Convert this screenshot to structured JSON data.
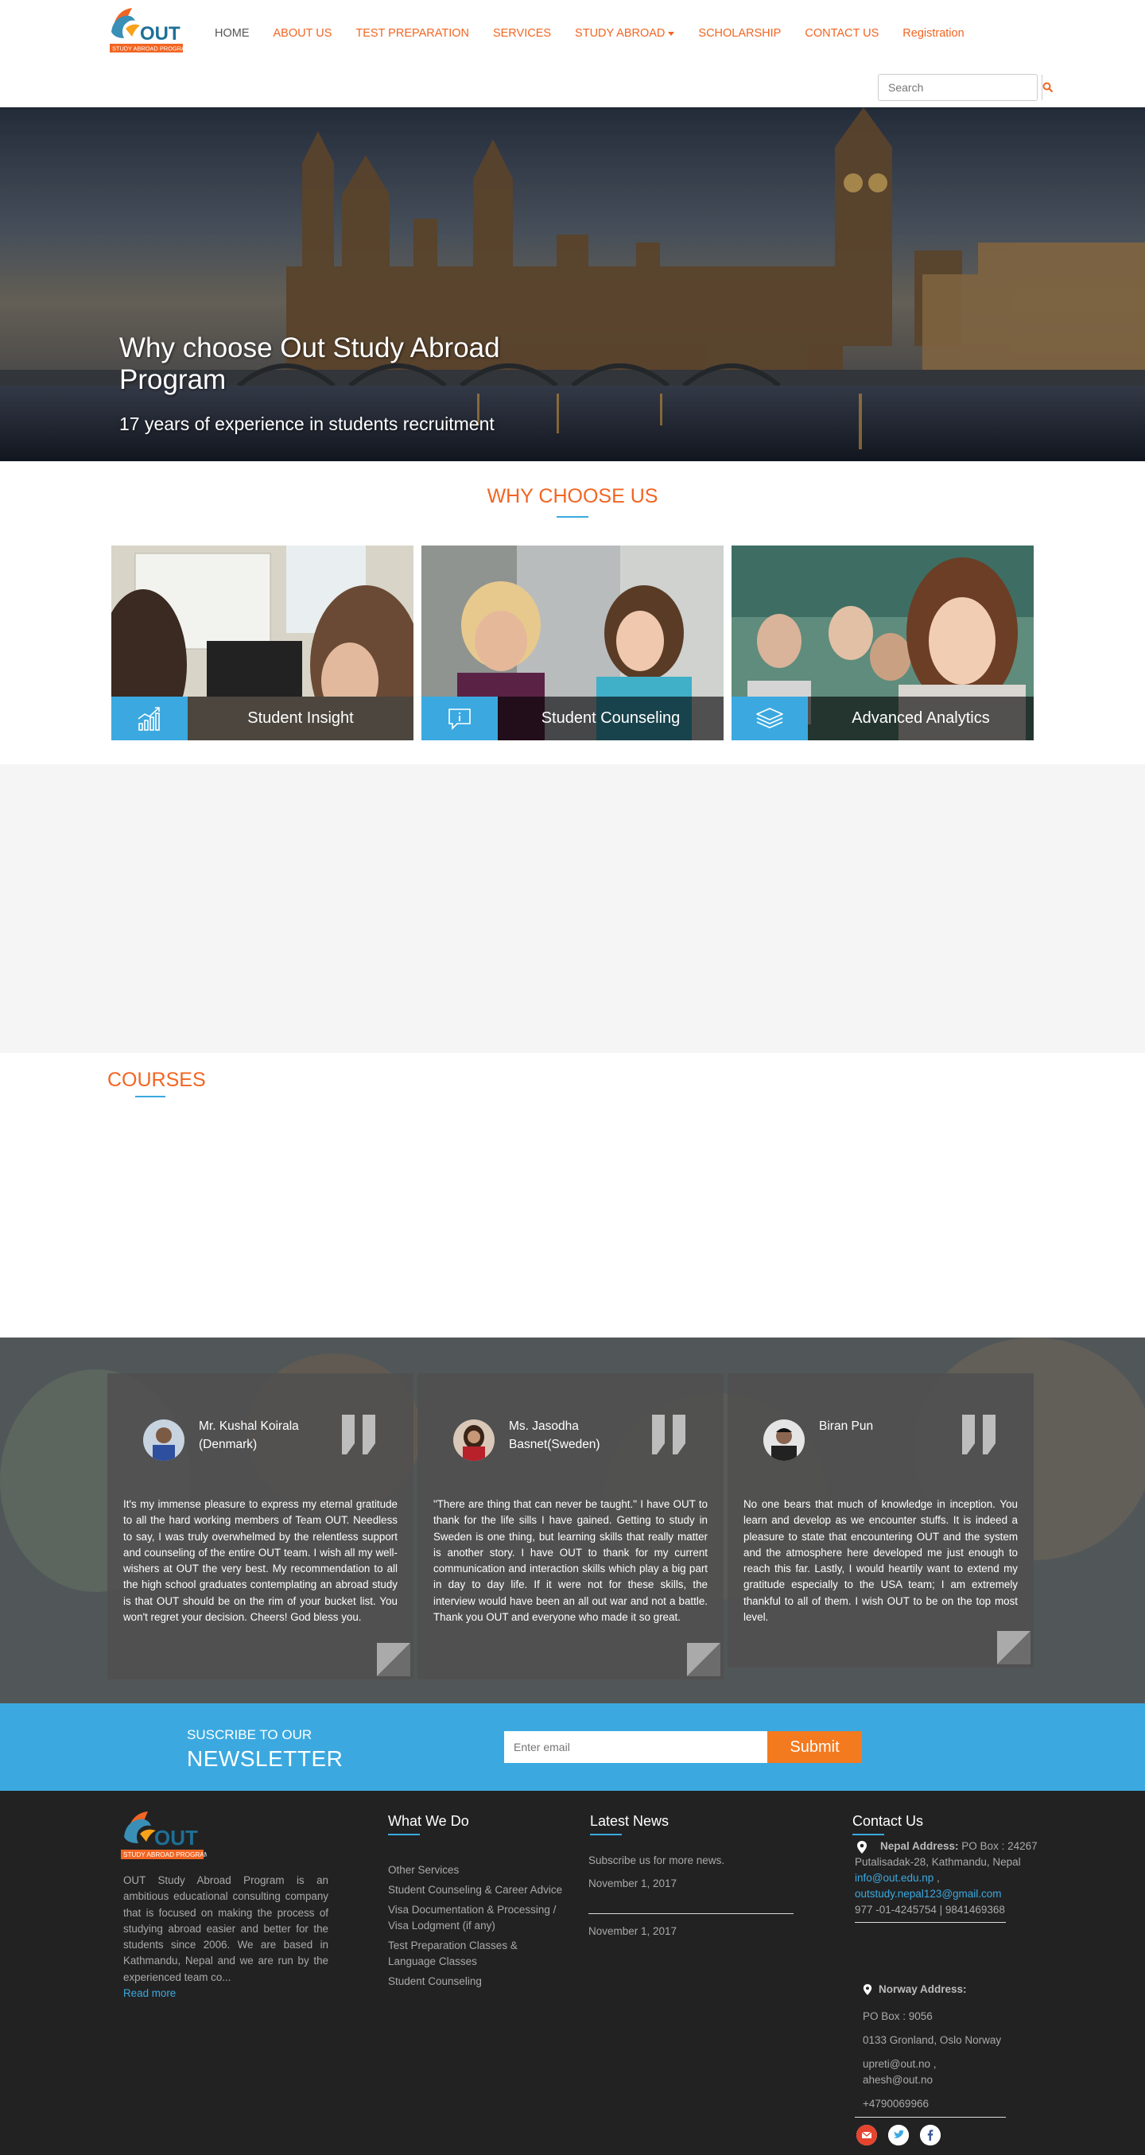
{
  "brand": {
    "logo_text": "OUT",
    "logo_sub": "STUDY ABROAD PROGRAMS"
  },
  "nav": {
    "items": [
      {
        "label": "HOME"
      },
      {
        "label": "ABOUT US"
      },
      {
        "label": "TEST PREPARATION"
      },
      {
        "label": "SERVICES"
      },
      {
        "label": "STUDY ABROAD"
      },
      {
        "label": "SCHOLARSHIP"
      },
      {
        "label": "CONTACT US"
      },
      {
        "label": "Registration"
      }
    ]
  },
  "search": {
    "placeholder": "Search",
    "icon": "search-icon"
  },
  "hero": {
    "title": "Why choose Out Study Abroad Program",
    "subtitle": "17 years of experience in students recruitment"
  },
  "why": {
    "title": "WHY CHOOSE US",
    "cards": [
      {
        "label": "Student Insight",
        "icon": "chart-growth-icon"
      },
      {
        "label": "Student Counseling",
        "icon": "info-speech-icon"
      },
      {
        "label": "Advanced Analytics",
        "icon": "layers-icon"
      }
    ]
  },
  "courses": {
    "title": "COURSES"
  },
  "testimonials": [
    {
      "name": "Mr. Kushal Koirala (Denmark)",
      "text": "It's my immense pleasure to express my eternal gratitude to all the hard working members of Team OUT. Needless to say, I was truly overwhelmed by the relentless support and counseling of the entire OUT team. I wish all my well-wishers at OUT the very best. My recommendation to all the high school graduates contemplating an abroad study is that OUT should be on the rim of your bucket list. You won't regret your decision. Cheers! God bless you."
    },
    {
      "name": "Ms. Jasodha Basnet(Sweden)",
      "text": "\"There are thing that can never be taught.\" I have OUT to thank for the life sills I have gained. Getting to study in Sweden is one thing, but learning skills that really matter is another story. I have OUT to thank for my current communication and interaction skills which play a big part in day to day life. If it were not for these skills, the interview would have been an all out war and not a battle. Thank you OUT and everyone who made it so great."
    },
    {
      "name": "Biran Pun",
      "text": "No one bears that much of knowledge in inception. You learn and develop as we encounter stuffs. It is indeed a pleasure to state that encountering OUT and the system and the atmosphere here developed me just enough to reach this far. Lastly, I would heartily want to extend my gratitude especially to the USA team; I am extremely thankful to all of them. I wish OUT to be on the top most level."
    }
  ],
  "newsletter": {
    "small": "SUSCRIBE TO OUR",
    "big": "NEWSLETTER",
    "placeholder": "Enter email",
    "button": "Submit"
  },
  "footer": {
    "about": "OUT Study Abroad Program is an ambitious educational consulting company that is focused on making the process of studying abroad easier and better for the students since 2006. We are based in Kathmandu, Nepal and we are run by the experienced team co...",
    "read_more": "Read more",
    "what_we_do": {
      "title": "What We Do",
      "items": [
        "Other Services",
        "Student Counseling & Career Advice",
        "Visa Documentation & Processing / Visa Lodgment (if any)",
        "Test Preparation Classes & Language Classes",
        "Student Counseling"
      ]
    },
    "news": {
      "title": "Latest News",
      "intro": "Subscribe us for more news.",
      "dates": [
        "November 1, 2017",
        "November 1, 2017"
      ]
    },
    "contact": {
      "title": "Contact Us",
      "nepal_label": "Nepal Address:",
      "nepal_address": "PO Box : 24267 Putalisadak-28, Kathmandu, Nepal",
      "email1": "info@out.edu.np",
      "email_sep": ",",
      "email2": "outstudy.nepal123@gmail.com",
      "phones": "977 -01-4245754 | 9841469368",
      "norway_label": "Norway Address:",
      "norway_pobox": "PO Box : 9056",
      "norway_street": "0133 Gronland, Oslo Norway",
      "norway_emails": "upreti@out.no , ahesh@out.no",
      "norway_phone": "+4790069966"
    },
    "socials": [
      "email-icon",
      "twitter-icon",
      "facebook-icon"
    ]
  },
  "colors": {
    "accent": "#f26522",
    "blue": "#3ba9e0",
    "footer_bg": "#222222"
  }
}
